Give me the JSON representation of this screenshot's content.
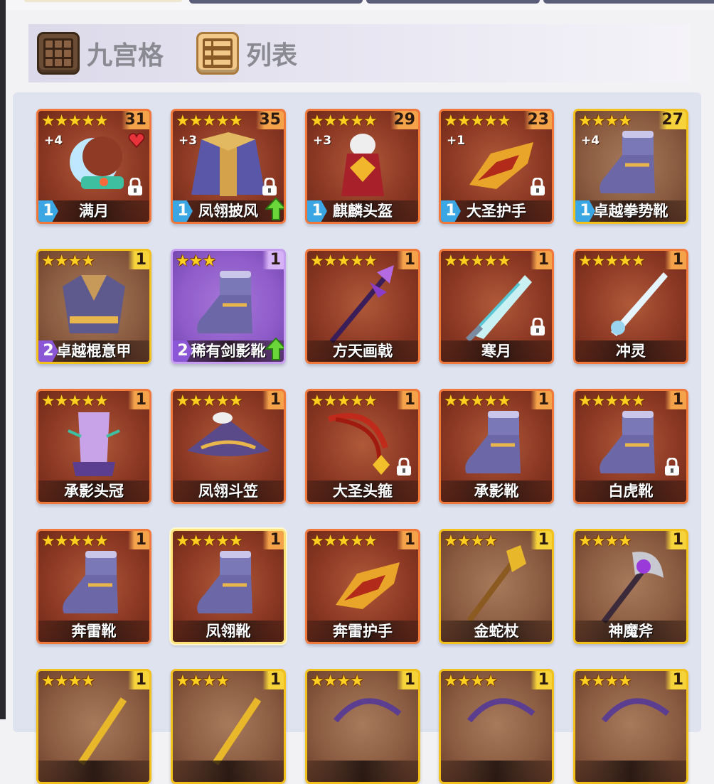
{
  "view_switch": {
    "grid_label": "九宫格",
    "list_label": "列表"
  },
  "colors": {
    "red_frame": "#f0783a",
    "gold_frame": "#f3c11c",
    "purple_frame": "#c79df0",
    "star": "#ffcf1f",
    "panel_bg": "#dfe3f0"
  },
  "items": [
    {
      "name": "满月",
      "stars": 5,
      "level": "31",
      "refine": "+4",
      "rarity": "red",
      "slot": "1",
      "locked": true,
      "favorite": true,
      "upgrade": false,
      "icon": "crescent-moon-amulet-icon"
    },
    {
      "name": "凤翎披风",
      "stars": 5,
      "level": "35",
      "refine": "+3",
      "rarity": "red",
      "slot": "1",
      "locked": true,
      "favorite": false,
      "upgrade": true,
      "icon": "phoenix-cloak-icon"
    },
    {
      "name": "麒麟头盔",
      "stars": 5,
      "level": "29",
      "refine": "+3",
      "rarity": "red",
      "slot": "1",
      "locked": false,
      "favorite": false,
      "upgrade": false,
      "icon": "qilin-helmet-icon"
    },
    {
      "name": "大圣护手",
      "stars": 5,
      "level": "23",
      "refine": "+1",
      "rarity": "red",
      "slot": "1",
      "locked": true,
      "favorite": false,
      "upgrade": false,
      "icon": "gauntlet-icon"
    },
    {
      "name": "卓越拳势靴",
      "stars": 4,
      "level": "27",
      "refine": "+4",
      "rarity": "gold",
      "slot": "1",
      "locked": false,
      "favorite": false,
      "upgrade": false,
      "icon": "boot-icon"
    },
    {
      "name": "卓越棍意甲",
      "stars": 4,
      "level": "1",
      "refine": "",
      "rarity": "gold",
      "slot": "2",
      "locked": false,
      "favorite": false,
      "upgrade": false,
      "icon": "robe-armor-icon"
    },
    {
      "name": "稀有剑影靴",
      "stars": 3,
      "level": "1",
      "refine": "",
      "rarity": "purple",
      "slot": "2",
      "locked": false,
      "favorite": false,
      "upgrade": true,
      "icon": "boot-icon"
    },
    {
      "name": "方天画戟",
      "stars": 5,
      "level": "1",
      "refine": "",
      "rarity": "red",
      "slot": "",
      "locked": false,
      "favorite": false,
      "upgrade": false,
      "icon": "halberd-icon"
    },
    {
      "name": "寒月",
      "stars": 5,
      "level": "1",
      "refine": "",
      "rarity": "red",
      "slot": "",
      "locked": true,
      "favorite": false,
      "upgrade": false,
      "icon": "ice-blade-icon"
    },
    {
      "name": "冲灵",
      "stars": 5,
      "level": "1",
      "refine": "",
      "rarity": "red",
      "slot": "",
      "locked": false,
      "favorite": false,
      "upgrade": false,
      "icon": "sword-icon"
    },
    {
      "name": "承影头冠",
      "stars": 5,
      "level": "1",
      "refine": "",
      "rarity": "red",
      "slot": "",
      "locked": false,
      "favorite": false,
      "upgrade": false,
      "icon": "crown-icon"
    },
    {
      "name": "凤翎斗笠",
      "stars": 5,
      "level": "1",
      "refine": "",
      "rarity": "red",
      "slot": "",
      "locked": false,
      "favorite": false,
      "upgrade": false,
      "icon": "bamboo-hat-icon"
    },
    {
      "name": "大圣头箍",
      "stars": 5,
      "level": "1",
      "refine": "",
      "rarity": "red",
      "slot": "",
      "locked": true,
      "favorite": false,
      "upgrade": false,
      "icon": "headband-icon"
    },
    {
      "name": "承影靴",
      "stars": 5,
      "level": "1",
      "refine": "",
      "rarity": "red",
      "slot": "",
      "locked": false,
      "favorite": false,
      "upgrade": false,
      "icon": "boot-icon"
    },
    {
      "name": "白虎靴",
      "stars": 5,
      "level": "1",
      "refine": "",
      "rarity": "red",
      "slot": "",
      "locked": true,
      "favorite": false,
      "upgrade": false,
      "icon": "boot-icon"
    },
    {
      "name": "奔雷靴",
      "stars": 5,
      "level": "1",
      "refine": "",
      "rarity": "red",
      "slot": "",
      "locked": false,
      "favorite": false,
      "upgrade": false,
      "icon": "boot-icon"
    },
    {
      "name": "凤翎靴",
      "stars": 5,
      "level": "1",
      "refine": "",
      "rarity": "red",
      "slot": "",
      "locked": false,
      "favorite": false,
      "upgrade": false,
      "selected": true,
      "icon": "boot-icon"
    },
    {
      "name": "奔雷护手",
      "stars": 5,
      "level": "1",
      "refine": "",
      "rarity": "red",
      "slot": "",
      "locked": false,
      "favorite": false,
      "upgrade": false,
      "icon": "gauntlet-icon"
    },
    {
      "name": "金蛇杖",
      "stars": 4,
      "level": "1",
      "refine": "",
      "rarity": "gold",
      "slot": "",
      "locked": false,
      "favorite": false,
      "upgrade": false,
      "icon": "snake-staff-icon"
    },
    {
      "name": "神魔斧",
      "stars": 4,
      "level": "1",
      "refine": "",
      "rarity": "gold",
      "slot": "",
      "locked": false,
      "favorite": false,
      "upgrade": false,
      "icon": "axe-icon"
    },
    {
      "name": "",
      "stars": 4,
      "level": "1",
      "refine": "",
      "rarity": "gold",
      "slot": "",
      "locked": false,
      "favorite": false,
      "upgrade": false,
      "icon": "weapon-icon"
    },
    {
      "name": "",
      "stars": 4,
      "level": "1",
      "refine": "",
      "rarity": "gold",
      "slot": "",
      "locked": false,
      "favorite": false,
      "upgrade": false,
      "icon": "weapon-icon"
    },
    {
      "name": "",
      "stars": 4,
      "level": "1",
      "refine": "",
      "rarity": "gold",
      "slot": "",
      "locked": false,
      "favorite": false,
      "upgrade": false,
      "icon": "bow-icon"
    },
    {
      "name": "",
      "stars": 4,
      "level": "1",
      "refine": "",
      "rarity": "gold",
      "slot": "",
      "locked": false,
      "favorite": false,
      "upgrade": false,
      "icon": "bow-icon"
    },
    {
      "name": "",
      "stars": 4,
      "level": "1",
      "refine": "",
      "rarity": "gold",
      "slot": "",
      "locked": false,
      "favorite": false,
      "upgrade": false,
      "icon": "bow-icon"
    }
  ]
}
